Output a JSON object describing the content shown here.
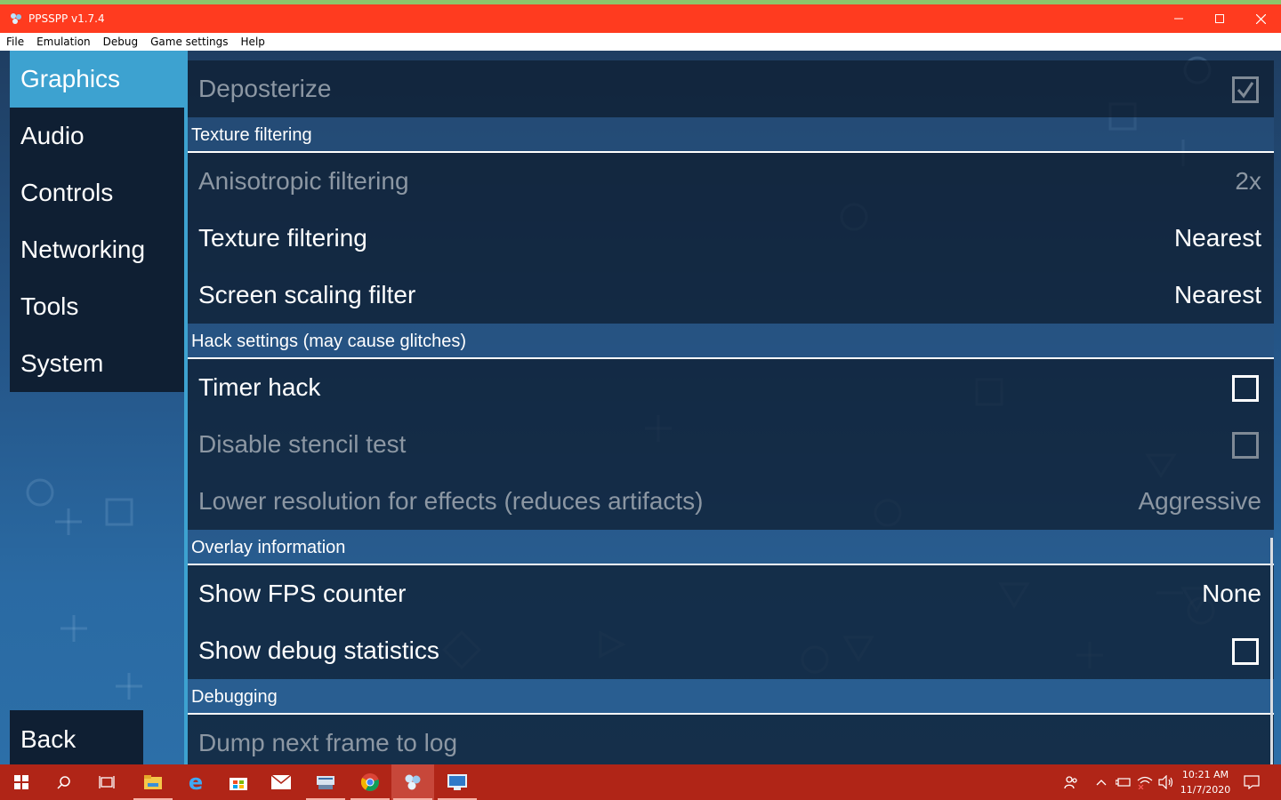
{
  "window": {
    "title": "PPSSPP v1.7.4",
    "accent": "#ff3b1f"
  },
  "menu": [
    "File",
    "Emulation",
    "Debug",
    "Game settings",
    "Help"
  ],
  "tabs": [
    {
      "label": "Graphics",
      "active": true
    },
    {
      "label": "Audio"
    },
    {
      "label": "Controls"
    },
    {
      "label": "Networking"
    },
    {
      "label": "Tools"
    },
    {
      "label": "System"
    }
  ],
  "back_label": "Back",
  "settings": {
    "deposterize": {
      "label": "Deposterize",
      "checked": true,
      "disabled": true
    },
    "texture_filtering_header": "Texture filtering",
    "anisotropic": {
      "label": "Anisotropic filtering",
      "value": "2x",
      "disabled": true
    },
    "texture_filtering": {
      "label": "Texture filtering",
      "value": "Nearest"
    },
    "screen_scaling": {
      "label": "Screen scaling filter",
      "value": "Nearest"
    },
    "hack_header": "Hack settings (may cause glitches)",
    "timer_hack": {
      "label": "Timer hack",
      "checked": false
    },
    "disable_stencil": {
      "label": "Disable stencil test",
      "checked": false,
      "disabled": true
    },
    "lower_res": {
      "label": "Lower resolution for effects (reduces artifacts)",
      "value": "Aggressive",
      "disabled": true
    },
    "overlay_header": "Overlay information",
    "show_fps": {
      "label": "Show FPS counter",
      "value": "None"
    },
    "show_debug": {
      "label": "Show debug statistics",
      "checked": false
    },
    "debugging_header": "Debugging",
    "dump_frame": {
      "label": "Dump next frame to log",
      "disabled": true
    }
  },
  "taskbar": {
    "icons": [
      "windows-start-icon",
      "search-icon",
      "task-view-icon",
      "file-explorer-icon",
      "edge-icon",
      "store-icon",
      "mail-icon",
      "scanner-icon",
      "chrome-icon",
      "ppsspp-icon",
      "remote-desktop-icon"
    ],
    "time": "10:21 AM",
    "date": "11/7/2020"
  }
}
